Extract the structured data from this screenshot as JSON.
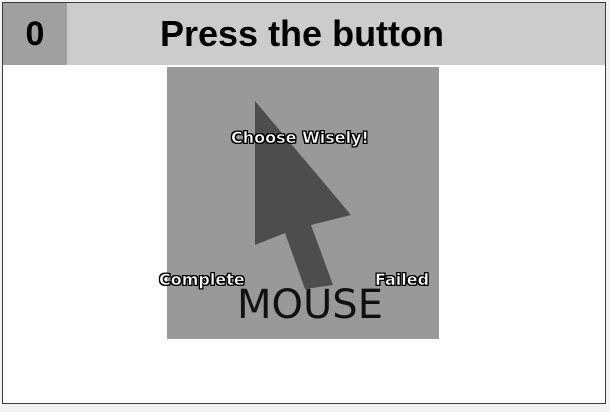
{
  "header": {
    "score": "0",
    "title": "Press the button"
  },
  "game": {
    "prompt": "Choose Wisely!",
    "buttons": {
      "complete": "Complete",
      "failed": "Failed"
    },
    "device_label": "MOUSE",
    "cursor_icon": "mouse-pointer-icon"
  },
  "colors": {
    "header_bg": "#cccccc",
    "score_bg": "#a0a0a0",
    "game_bg": "#999999",
    "cursor": "#4d4d4d"
  }
}
